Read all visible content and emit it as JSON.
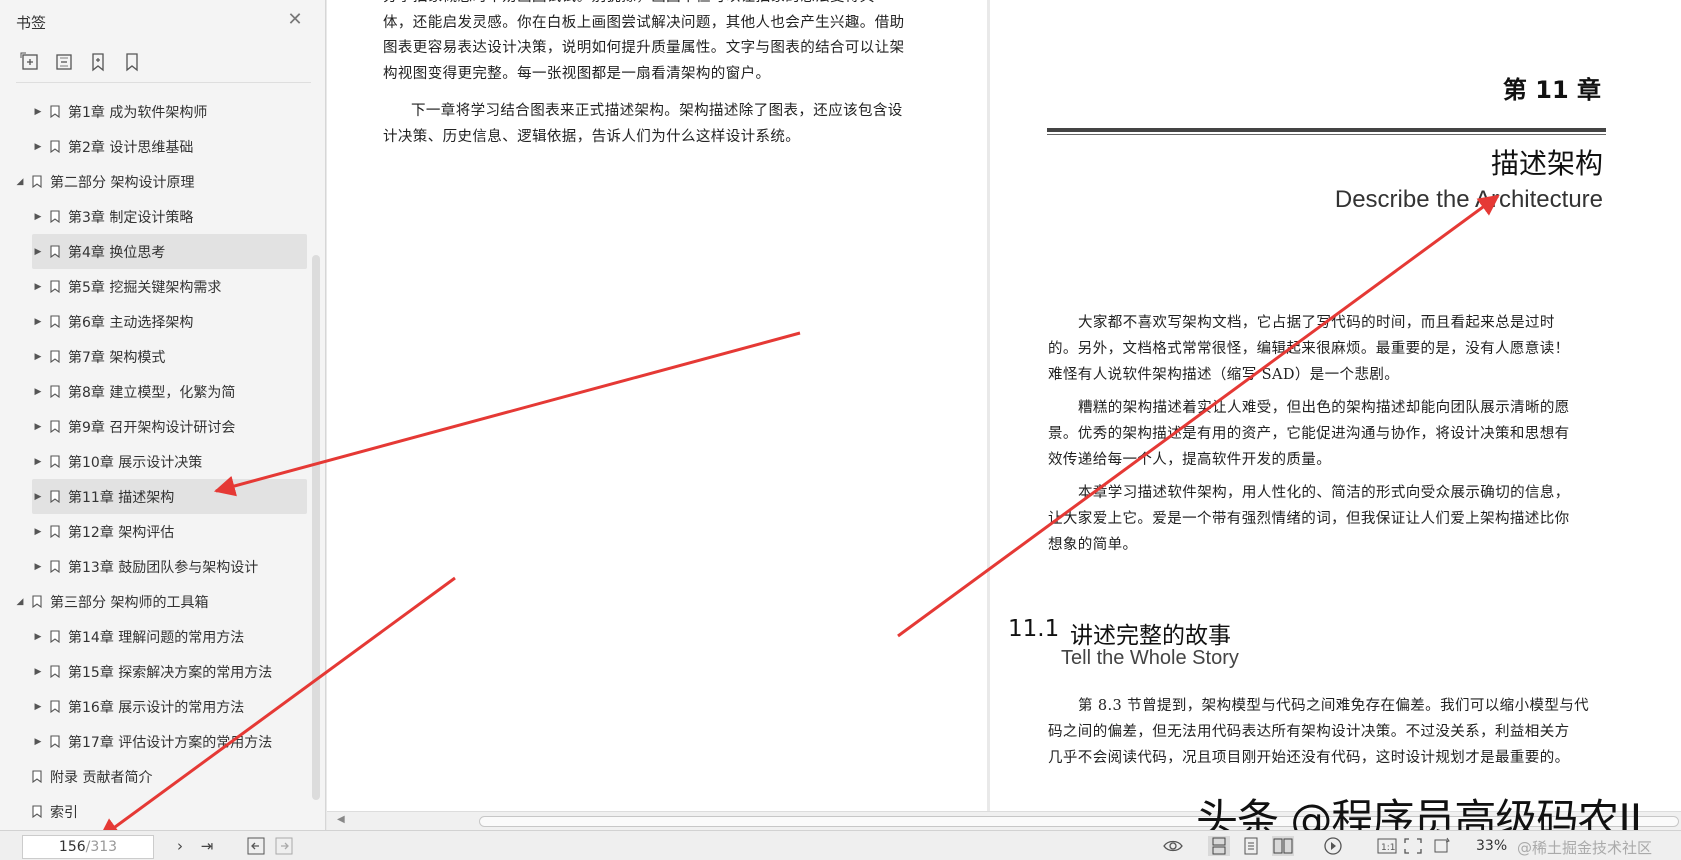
{
  "sidebar": {
    "title": "书签",
    "tools": [
      "expand-all-icon",
      "collapse-all-icon",
      "add-bookmark-icon",
      "bookmark-icon"
    ],
    "items": [
      {
        "label": "第1章  成为软件架构师",
        "level": 1,
        "state": "collapsed"
      },
      {
        "label": "第2章  设计思维基础",
        "level": 1,
        "state": "collapsed"
      },
      {
        "label": "第二部分  架构设计原理",
        "level": 0,
        "state": "expanded"
      },
      {
        "label": "第3章  制定设计策略",
        "level": 1,
        "state": "collapsed"
      },
      {
        "label": "第4章  换位思考",
        "level": 1,
        "state": "collapsed",
        "hover": true
      },
      {
        "label": "第5章  挖掘关键架构需求",
        "level": 1,
        "state": "collapsed"
      },
      {
        "label": "第6章  主动选择架构",
        "level": 1,
        "state": "collapsed"
      },
      {
        "label": "第7章  架构模式",
        "level": 1,
        "state": "collapsed"
      },
      {
        "label": "第8章  建立模型，化繁为简",
        "level": 1,
        "state": "collapsed"
      },
      {
        "label": "第9章  召开架构设计研讨会",
        "level": 1,
        "state": "collapsed"
      },
      {
        "label": "第10章  展示设计决策",
        "level": 1,
        "state": "collapsed"
      },
      {
        "label": "第11章  描述架构",
        "level": 1,
        "state": "collapsed",
        "selected": true
      },
      {
        "label": "第12章  架构评估",
        "level": 1,
        "state": "collapsed"
      },
      {
        "label": "第13章  鼓励团队参与架构设计",
        "level": 1,
        "state": "collapsed"
      },
      {
        "label": "第三部分  架构师的工具箱",
        "level": 0,
        "state": "expanded"
      },
      {
        "label": "第14章  理解问题的常用方法",
        "level": 1,
        "state": "collapsed"
      },
      {
        "label": "第15章  探索解决方案的常用方法",
        "level": 1,
        "state": "collapsed"
      },
      {
        "label": "第16章  展示设计的常用方法",
        "level": 1,
        "state": "collapsed"
      },
      {
        "label": "第17章  评估设计方案的常用方法",
        "level": 1,
        "state": "collapsed"
      },
      {
        "label": "附录  贡献者简介",
        "level": 0,
        "state": "leaf"
      },
      {
        "label": "索引",
        "level": 0,
        "state": "leaf"
      }
    ]
  },
  "left_page": {
    "lines": [
      "分享抽象概念时不妨画图试试。别犹豫，画图不但可以让抽象的想法变得具",
      "体，还能启发灵感。你在白板上画图尝试解决问题，其他人也会产生兴趣。借助",
      "图表更容易表达设计决策，说明如何提升质量属性。文字与图表的结合可以让架",
      "构视图变得更完整。每一张视图都是一扇看清架构的窗户。",
      "下一章将学习结合图表来正式描述架构。架构描述除了图表，还应该包含设",
      "计决策、历史信息、逻辑依据，告诉人们为什么这样设计系统。"
    ]
  },
  "right_page": {
    "chapter_number": "第 11 章",
    "chapter_title": "描述架构",
    "chapter_subtitle": "Describe the Architecture",
    "paragraphs": [
      [
        "大家都不喜欢写架构文档，它占据了写代码的时间，而且看起来总是过时",
        "的。另外，文档格式常常很怪，编辑起来很麻烦。最重要的是，没有人愿意读！",
        "难怪有人说软件架构描述（缩写 SAD）是一个悲剧。"
      ],
      [
        "糟糕的架构描述着实让人难受，但出色的架构描述却能向团队展示清晰的愿",
        "景。优秀的架构描述是有用的资产，它能促进沟通与协作，将设计决策和思想有",
        "效传递给每一个人，提高软件开发的质量。"
      ],
      [
        "本章学习描述软件架构，用人性化的、简洁的形式向受众展示确切的信息，",
        "让大家爱上它。爱是一个带有强烈情绪的词，但我保证让人们爱上架构描述比你",
        "想象的简单。"
      ]
    ],
    "section_number": "11.1",
    "section_title": "讲述完整的故事",
    "section_subtitle": "Tell the Whole Story",
    "section_paragraph": [
      "第 8.3 节曾提到，架构模型与代码之间难免存在偏差。我们可以缩小模型与代",
      "码之间的偏差，但无法用代码表达所有架构设计决策。不过没关系，利益相关方",
      "几乎不会阅读代码，况且项目刚开始还没有代码，这时设计规划才是最重要的。"
    ]
  },
  "statusbar": {
    "page_current": "156",
    "page_total": "/313",
    "zoom": "33%"
  },
  "watermark": {
    "main": "头条 @程序员高级码农II",
    "secondary": "@稀土掘金技术社区"
  },
  "colors": {
    "arrow": "#e53935",
    "sidebar_bg": "#f4f4f4",
    "selected_bg": "#e2e2e2"
  }
}
